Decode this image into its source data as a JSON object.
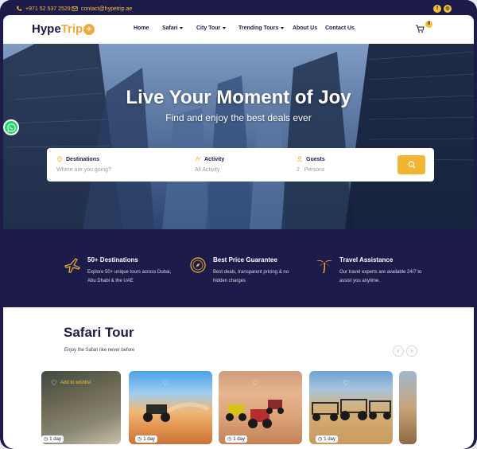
{
  "topbar": {
    "phone": "+971 52 537 2529",
    "email": "contact@hypetrip.ae",
    "social_icons": [
      "facebook-icon",
      "instagram-icon"
    ]
  },
  "nav": {
    "logo_part1": "Hype",
    "logo_part2": "Trip",
    "items": [
      {
        "label": "Home",
        "dropdown": false
      },
      {
        "label": "Safari",
        "dropdown": true
      },
      {
        "label": "City Tour",
        "dropdown": true
      },
      {
        "label": "Trending Tours",
        "dropdown": true
      },
      {
        "label": "About Us",
        "dropdown": false
      },
      {
        "label": "Contact Us",
        "dropdown": false
      }
    ],
    "cart_count": "0"
  },
  "hero": {
    "title": "Live Your Moment of Joy",
    "subtitle": "Find and enjoy the best deals ever"
  },
  "search": {
    "destinations_label": "Destinations",
    "destinations_placeholder": "Where are you going?",
    "activity_label": "Activity",
    "activity_placeholder": "All Activity",
    "guests_label": "Guests",
    "guests_count": "2",
    "guests_unit": "Persons"
  },
  "features": [
    {
      "title": "50+ Destinations",
      "desc": "Explore 50+ unique tours across Dubai, Abu Dhabi & the UAE",
      "icon": "plane-icon"
    },
    {
      "title": "Best Price Guarantee",
      "desc": "Best deals, transparent pricing & no hidden charges",
      "icon": "compass-icon"
    },
    {
      "title": "Travel Assistance",
      "desc": "Our travel experts are available 24/7 to assist you anytime.",
      "icon": "palm-tree-icon"
    }
  ],
  "safari": {
    "title": "Safari Tour",
    "subtitle": "Enjoy the Safari like never before",
    "cards": [
      {
        "wishlist": "Add to wishlist",
        "duration": "1 day"
      },
      {
        "wishlist": "",
        "duration": "1 day"
      },
      {
        "wishlist": "",
        "duration": "1 day"
      },
      {
        "wishlist": "",
        "duration": "1 day"
      },
      {
        "wishlist": "",
        "duration": ""
      }
    ]
  },
  "colors": {
    "navy": "#1c1b4a",
    "gold": "#f2c23b",
    "whatsapp": "#25d366"
  }
}
